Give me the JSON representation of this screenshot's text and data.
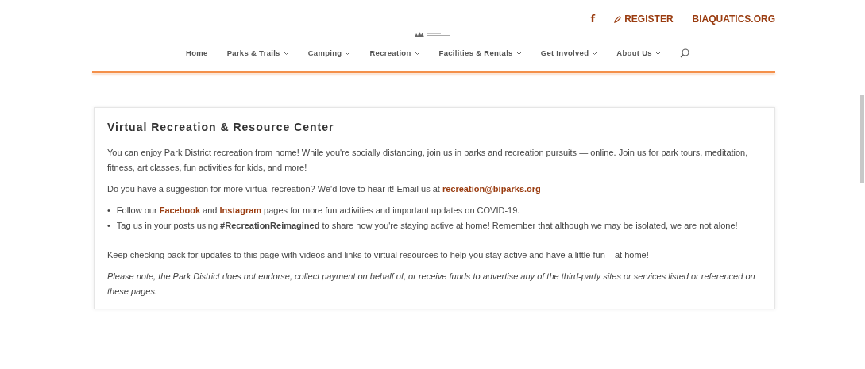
{
  "top_links": [
    {
      "kind": "facebook",
      "label": "f"
    },
    {
      "kind": "register",
      "label": "REGISTER"
    },
    {
      "kind": "plain",
      "label": "BIAQUATICS.ORG"
    }
  ],
  "nav": [
    {
      "label": "Home",
      "dropdown": false
    },
    {
      "label": "Parks & Trails",
      "dropdown": true
    },
    {
      "label": "Camping",
      "dropdown": true
    },
    {
      "label": "Recreation",
      "dropdown": true
    },
    {
      "label": "Facilities & Rentals",
      "dropdown": true
    },
    {
      "label": "Get Involved",
      "dropdown": true
    },
    {
      "label": "About Us",
      "dropdown": true
    }
  ],
  "card": {
    "title": "Virtual Recreation & Resource Center",
    "blocks": [
      {
        "kind": "paragraph",
        "segments": [
          {
            "kind": "text",
            "text": "You can enjoy Park District recreation from home! While you're socially distancing, join us in parks and recreation pursuits — online. Join us for park tours, meditation, fitness, art classes, fun activities for kids, and more!"
          }
        ]
      },
      {
        "kind": "paragraph",
        "segments": [
          {
            "kind": "text",
            "text": "Do you have a suggestion for more virtual recreation? We'd love to hear it! Email us at "
          },
          {
            "kind": "link",
            "text": "recreation@biparks.org"
          }
        ]
      },
      {
        "kind": "bullets",
        "items": [
          {
            "marker": "•",
            "segments": [
              {
                "kind": "text",
                "text": "Follow our "
              },
              {
                "kind": "link",
                "text": "Facebook"
              },
              {
                "kind": "text",
                "text": " and "
              },
              {
                "kind": "link",
                "text": "Instagram"
              },
              {
                "kind": "text",
                "text": " pages for more fun activities and important updates on COVID-19."
              }
            ]
          },
          {
            "marker": "•",
            "segments": [
              {
                "kind": "text",
                "text": "Tag us in your posts using **#RecreationReimagined** to share how you're staying active at home! Remember that although we may be isolated, we are not alone!"
              }
            ]
          }
        ]
      },
      {
        "kind": "paragraph",
        "segments": [
          {
            "kind": "text",
            "text": "Keep checking back for updates to this page with videos and links to virtual resources to help you stay active and have a little fun – at home!"
          }
        ]
      },
      {
        "kind": "note",
        "segments": [
          {
            "kind": "text",
            "text": "Please note, the Park District does not endorse, collect payment on behalf of, or receive funds to advertise any of the third-party sites or services listed or referenced on these pages."
          }
        ]
      }
    ]
  }
}
